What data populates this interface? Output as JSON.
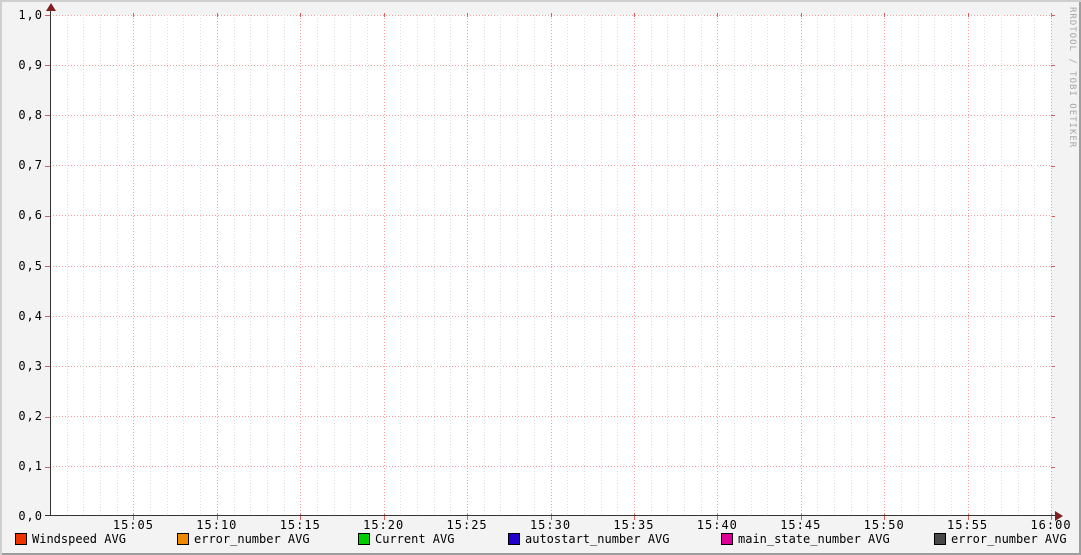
{
  "watermark": "RRDTOOL / TOBI OETIKER",
  "colors": {
    "background": "#f3f3f3",
    "canvas": "#ffffff",
    "major_grid": "#f79f9f",
    "minor_grid": "#dcdcdc",
    "axis": "#333333",
    "arrow": "#7f1f1f",
    "shade_top_left": "#cfcfcf",
    "shade_bottom_right": "#9e9e9e",
    "watermark_text": "#a6a6a6"
  },
  "chart_data": {
    "type": "line",
    "title": "",
    "xlabel": "",
    "ylabel": "",
    "ylim": [
      0.0,
      1.0
    ],
    "y_tick_step": 0.1,
    "y_ticks": [
      "1,0",
      "0,9",
      "0,8",
      "0,7",
      "0,6",
      "0,5",
      "0,4",
      "0,3",
      "0,2",
      "0,1",
      "0,0"
    ],
    "x_range": [
      "15:00",
      "16:00"
    ],
    "x_ticks": [
      "15:05",
      "15:10",
      "15:15",
      "15:20",
      "15:25",
      "15:30",
      "15:35",
      "15:40",
      "15:45",
      "15:50",
      "15:55",
      "16:00"
    ],
    "x_major_every_minutes": 5,
    "x_minor_every_minutes": 1,
    "grid": true,
    "legend_position": "bottom",
    "series": [
      {
        "name": "Windspeed AVG",
        "color": "#ee3300",
        "values": []
      },
      {
        "name": "error_number AVG",
        "color": "#ee8800",
        "values": []
      },
      {
        "name": "Current AVG",
        "color": "#00cc00",
        "values": []
      },
      {
        "name": "autostart_number AVG",
        "color": "#2200cc",
        "values": []
      },
      {
        "name": "main_state_number AVG",
        "color": "#dd0099",
        "values": []
      },
      {
        "name": "error_number AVG",
        "color": "#484848",
        "values": []
      }
    ]
  }
}
